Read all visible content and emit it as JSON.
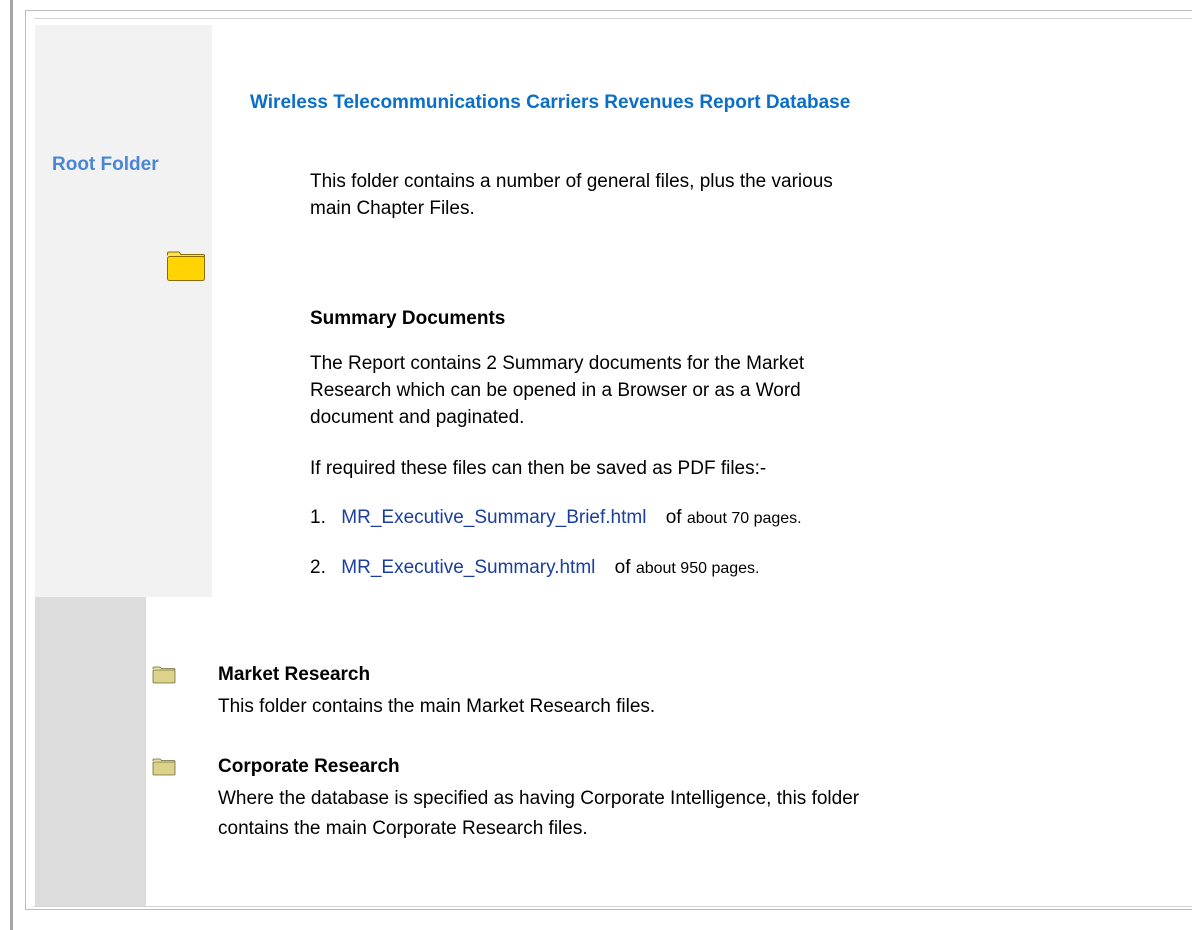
{
  "header": {
    "title": "Wireless Telecommunications Carriers Revenues Report Database"
  },
  "sidebar": {
    "root_folder_label": "Root Folder",
    "folder_icon": "folder-icon"
  },
  "intro": {
    "line1": "This folder contains a number of general files, plus the various",
    "line2": "main Chapter Files."
  },
  "summary": {
    "heading": "Summary Documents",
    "desc_line1": "The Report contains 2 Summary documents for the Market",
    "desc_line2": "Research which can be opened in a Browser or as a Word",
    "desc_line3": "document and paginated.",
    "pdf_note": "If required these files can then be saved as PDF files:-",
    "documents": [
      {
        "number": "1.",
        "link_text": "MR_Executive_Summary_Brief.html",
        "of_text": "of",
        "pages_text": "about 70 pages."
      },
      {
        "number": "2.",
        "link_text": "MR_Executive_Summary.html",
        "of_text": "of",
        "pages_text": "about 950 pages."
      }
    ]
  },
  "folders": [
    {
      "title": "Market Research",
      "desc_line1": "This folder contains the main Market Research files.",
      "desc_line2": ""
    },
    {
      "title": "Corporate Research",
      "desc_line1": "Where the database is specified as having Corporate Intelligence, this folder",
      "desc_line2": "contains the main Corporate Research files."
    }
  ],
  "colors": {
    "title": "#0b6fc9",
    "root_label": "#4a86d6",
    "link": "#1a3ea0",
    "folder_fill": "#ffd400",
    "folder_stroke": "#8a6d00",
    "small_folder_fill": "#dcd28a"
  }
}
